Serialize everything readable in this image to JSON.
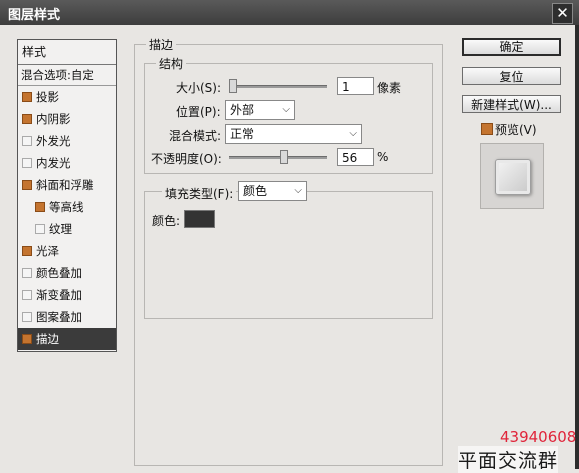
{
  "window": {
    "title": "图层样式",
    "close_glyph": "✕"
  },
  "styles_panel": {
    "header": "样式",
    "blend_options": "混合选项:自定",
    "items": [
      {
        "label": "投影",
        "checked": true,
        "sub": false,
        "selected": false
      },
      {
        "label": "内阴影",
        "checked": true,
        "sub": false,
        "selected": false
      },
      {
        "label": "外发光",
        "checked": false,
        "sub": false,
        "selected": false
      },
      {
        "label": "内发光",
        "checked": false,
        "sub": false,
        "selected": false
      },
      {
        "label": "斜面和浮雕",
        "checked": true,
        "sub": false,
        "selected": false
      },
      {
        "label": "等高线",
        "checked": true,
        "sub": true,
        "selected": false
      },
      {
        "label": "纹理",
        "checked": false,
        "sub": true,
        "selected": false
      },
      {
        "label": "光泽",
        "checked": true,
        "sub": false,
        "selected": false
      },
      {
        "label": "颜色叠加",
        "checked": false,
        "sub": false,
        "selected": false
      },
      {
        "label": "渐变叠加",
        "checked": false,
        "sub": false,
        "selected": false
      },
      {
        "label": "图案叠加",
        "checked": false,
        "sub": false,
        "selected": false
      },
      {
        "label": "描边",
        "checked": true,
        "sub": false,
        "selected": true
      }
    ]
  },
  "stroke": {
    "section_title": "描边",
    "structure_title": "结构",
    "size_label": "大小(S):",
    "size_value": "1",
    "size_unit": "像素",
    "size_slider_fraction": 0.0,
    "position_label": "位置(P):",
    "position_value": "外部",
    "blend_mode_label": "混合模式:",
    "blend_mode_value": "正常",
    "opacity_label": "不透明度(O):",
    "opacity_value": "56",
    "opacity_unit": "%",
    "opacity_slider_fraction": 0.56,
    "fill_type_label": "填充类型(F):",
    "fill_type_value": "颜色",
    "color_label": "颜色:",
    "color_value": "#333333"
  },
  "buttons": {
    "ok": "确定",
    "reset": "复位",
    "new_style": "新建样式(W)...",
    "preview_label": "预览(V)",
    "preview_checked": true
  },
  "watermark": {
    "number": "43940608",
    "text": "平面交流群"
  },
  "colors": {
    "accent_check": "#c4742f",
    "selected_row": "#3b3b3b",
    "titlebar": "#4a4a4a"
  }
}
